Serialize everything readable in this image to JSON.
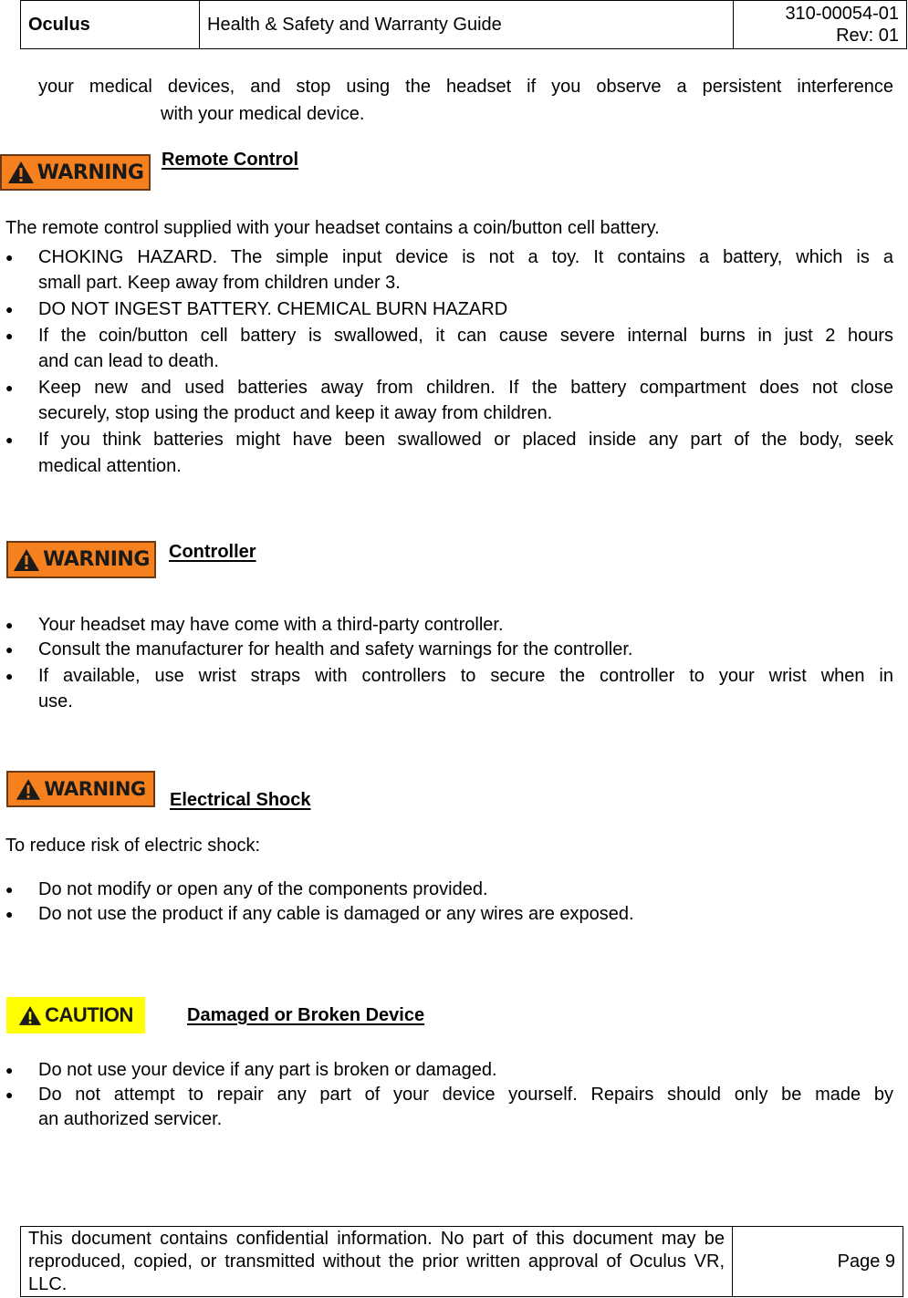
{
  "header": {
    "brand": "Oculus",
    "title": "Health & Safety and Warranty Guide",
    "doc_number": "310-00054-01",
    "revision": "Rev: 01"
  },
  "intro": {
    "line1": "your medical devices, and stop using the headset if you observe a persistent interference",
    "line2": "with your medical device."
  },
  "sections": [
    {
      "badge": "WARNING",
      "badge_icon": "warning-triangle-icon",
      "heading": "Remote Control",
      "paragraph": "The remote control supplied with your headset contains a coin/button cell battery.",
      "bullets": [
        [
          "CHOKING HAZARD.  The simple input device is not a toy.  It contains a battery, which is a",
          "small part.  Keep away from children under 3."
        ],
        [
          "DO NOT INGEST BATTERY.  CHEMICAL BURN HAZARD"
        ],
        [
          "If the coin/button cell battery is swallowed, it can cause severe internal burns in just 2 hours",
          "and can lead to death."
        ],
        [
          "Keep new and used batteries away from children.  If the battery compartment does not close",
          "securely, stop using the product and keep it away from children."
        ],
        [
          "If you think batteries might have been swallowed or placed inside any part of the body, seek",
          "medical attention."
        ]
      ]
    },
    {
      "badge": "WARNING",
      "badge_icon": "warning-triangle-icon",
      "heading": "Controller",
      "bullets": [
        [
          "Your headset may have come with a third-party controller."
        ],
        [
          "Consult the manufacturer for health and safety warnings for the controller."
        ],
        [
          "If available, use wrist straps with controllers to secure the controller to your wrist when in",
          "use."
        ]
      ]
    },
    {
      "badge": "WARNING",
      "badge_icon": "warning-triangle-icon",
      "heading": "Electrical Shock",
      "paragraph": "To reduce risk of electric shock:",
      "bullets": [
        [
          "Do not modify or open any of the components provided."
        ],
        [
          "Do not use the product if any cable is damaged or any wires are exposed."
        ]
      ]
    },
    {
      "badge": "CAUTION",
      "badge_icon": "caution-triangle-icon",
      "heading": "Damaged or Broken Device",
      "bullets": [
        [
          "Do not use your device if any part is broken or damaged."
        ],
        [
          "Do not attempt to repair any part of your device yourself.  Repairs should only be made by",
          "an authorized servicer."
        ]
      ]
    }
  ],
  "bullet_glyph": "●",
  "footer": {
    "notice": "This document contains confidential information. No part of this document may be reproduced, copied, or transmitted without the prior written approval of Oculus VR, LLC.",
    "page": "Page 9"
  },
  "colors": {
    "warning_badge": "#f7801e",
    "caution_badge": "#ffff00"
  }
}
